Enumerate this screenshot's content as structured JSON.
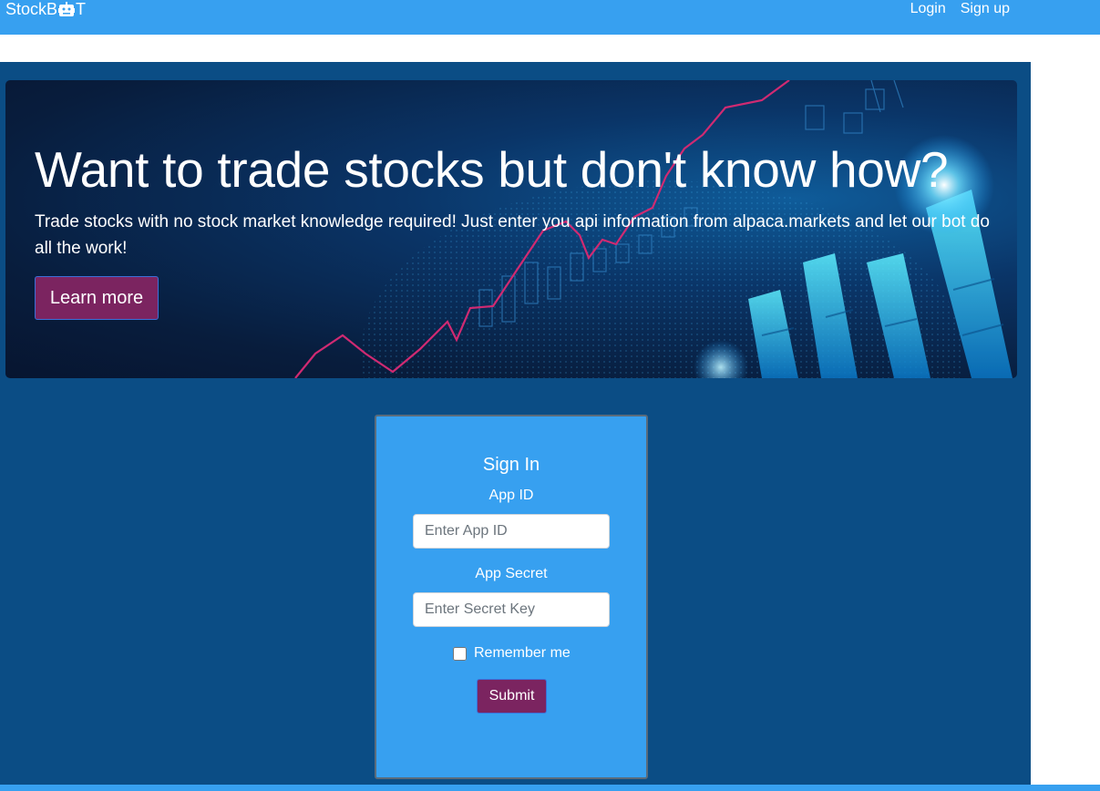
{
  "navbar": {
    "brand_prefix": "StockB",
    "brand_suffix": "T",
    "links": [
      "Login",
      "Sign up"
    ]
  },
  "hero": {
    "title": "Want to trade stocks but don't know how?",
    "text": "Trade stocks with no stock market knowledge required! Just enter you api information from alpaca.markets and let our bot do all the work!",
    "button_label": "Learn more"
  },
  "signin": {
    "title": "Sign In",
    "app_id_label": "App ID",
    "app_id_placeholder": "Enter App ID",
    "app_id_value": "",
    "secret_label": "App Secret",
    "secret_placeholder": "Enter Secret Key",
    "secret_value": "",
    "remember_label": "Remember me",
    "remember_checked": false,
    "submit_label": "Submit"
  },
  "colors": {
    "navbar": "#37a0f0",
    "main_bg": "#0b4d85",
    "card_bg": "#37a0f0",
    "button_bg": "#7b2460"
  }
}
